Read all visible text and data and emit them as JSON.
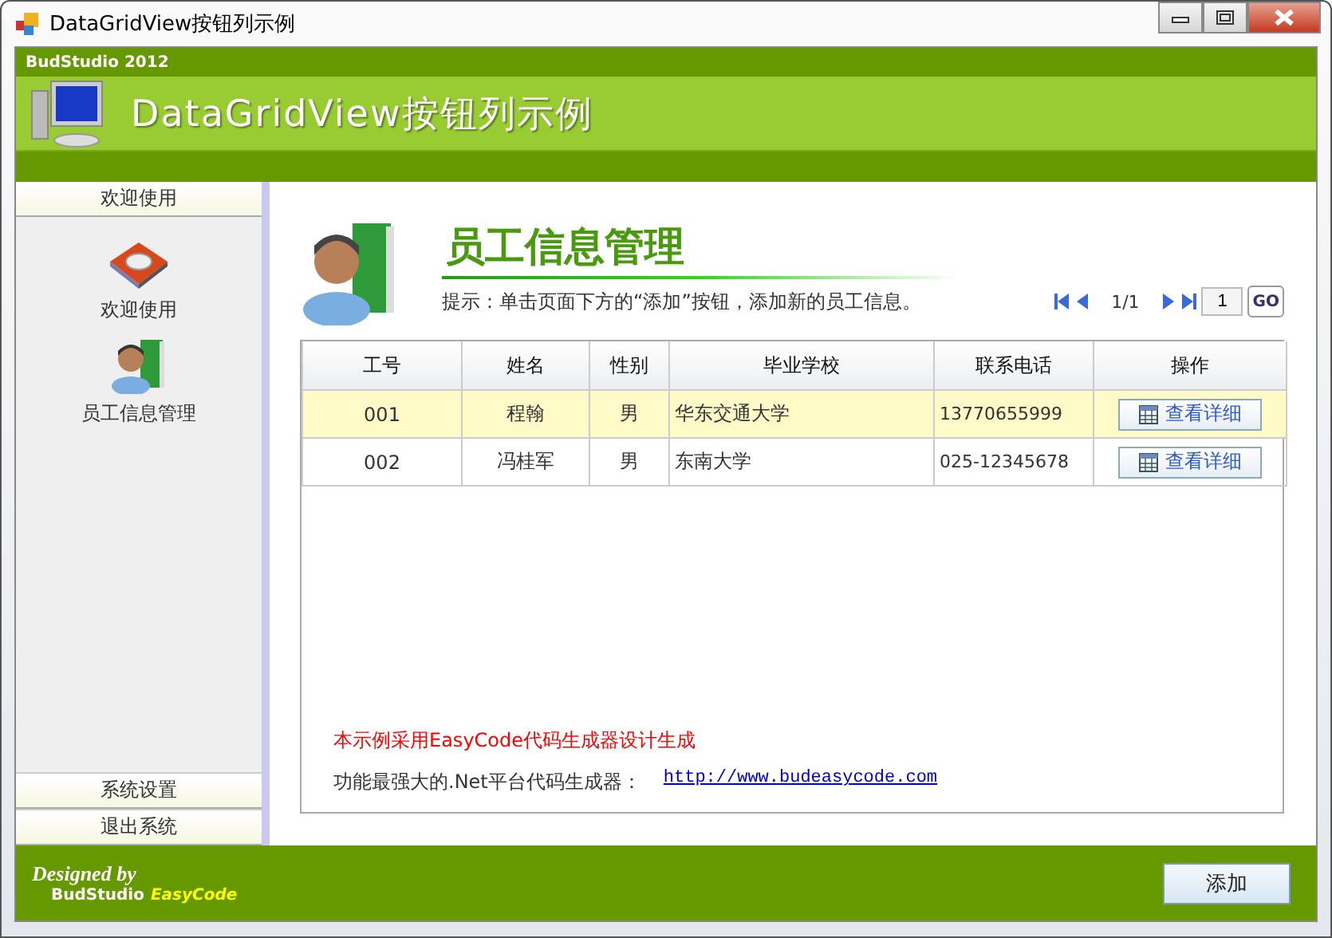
{
  "window": {
    "title": "DataGridView按钮列示例"
  },
  "header": {
    "brand": "BudStudio 2012",
    "title": "DataGridView按钮列示例"
  },
  "sidebar": {
    "sections": [
      {
        "label": "欢迎使用",
        "expanded": true,
        "items": [
          {
            "label": "欢迎使用",
            "kind": "mouse"
          },
          {
            "label": "员工信息管理",
            "kind": "staff"
          }
        ]
      },
      {
        "label": "系统设置",
        "expanded": false
      },
      {
        "label": "退出系统",
        "expanded": false
      }
    ]
  },
  "content": {
    "title": "员工信息管理",
    "hint": "提示：单击页面下方的“添加”按钮，添加新的员工信息。",
    "pager": {
      "page": "1/1",
      "input": "1",
      "go": "GO"
    },
    "table": {
      "columns": [
        "工号",
        "姓名",
        "性别",
        "毕业学校",
        "联系电话",
        "操作"
      ],
      "rows": [
        {
          "selected": true,
          "cells": [
            "001",
            "程翰",
            "男",
            "华东交通大学",
            "13770655999"
          ],
          "action": "查看详细"
        },
        {
          "selected": false,
          "cells": [
            "002",
            "冯桂军",
            "男",
            "东南大学",
            "025-12345678"
          ],
          "action": "查看详细"
        }
      ]
    },
    "notice": "本示例采用EasyCode代码生成器设计生成",
    "credit": "功能最强大的.Net平台代码生成器：",
    "link": "http://www.budeasycode.com"
  },
  "footer": {
    "designed_by": "Designed by",
    "brand": "BudStudio",
    "product": "EasyCode",
    "add_button": "添加"
  }
}
